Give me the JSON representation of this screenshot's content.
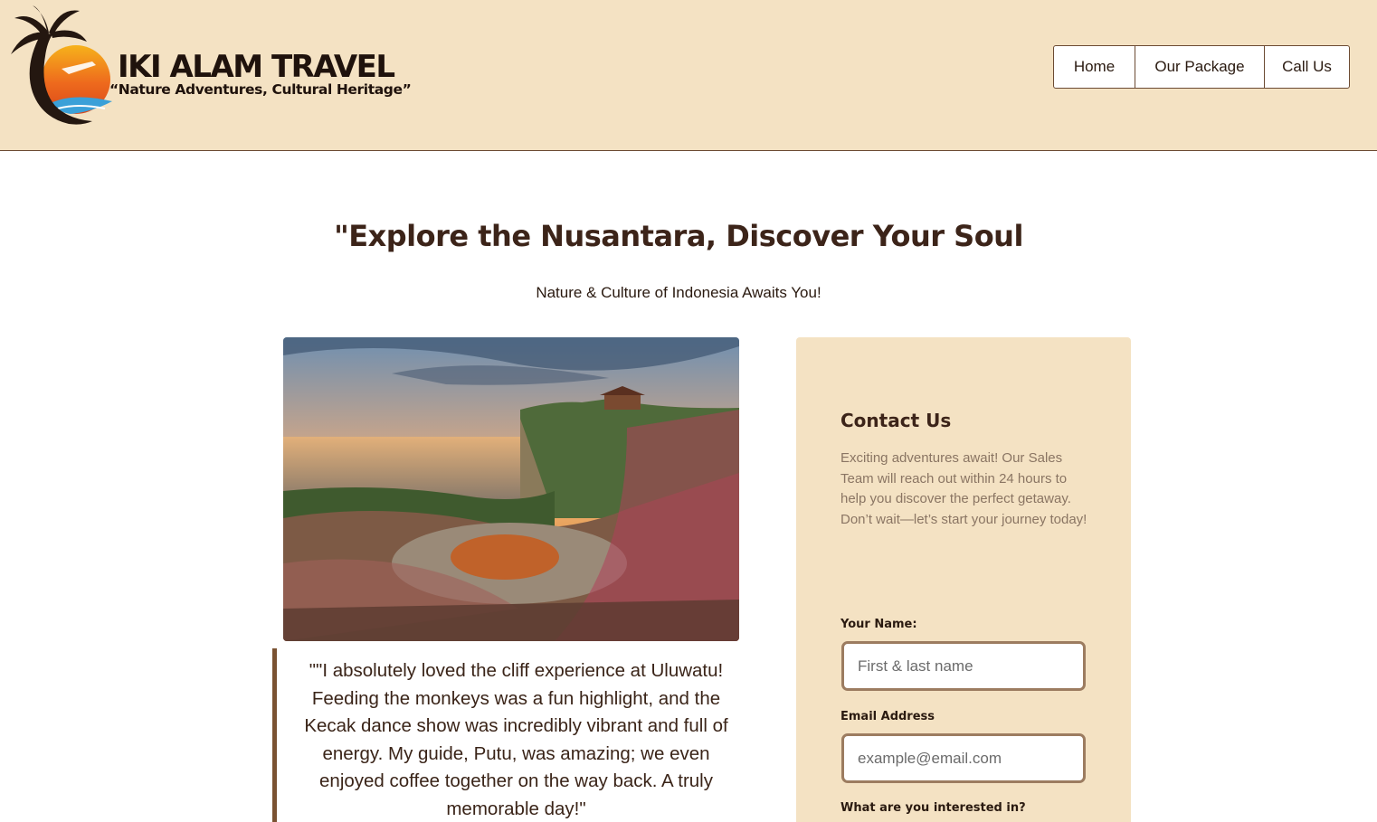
{
  "brand": {
    "name": "IKI ALAM TRAVEL",
    "tagline": "“Nature Adventures, Cultural Heritage”"
  },
  "nav": {
    "items": [
      {
        "label": "Home"
      },
      {
        "label": "Our Package"
      },
      {
        "label": "Call Us"
      }
    ]
  },
  "hero": {
    "title": "\"Explore the Nusantara, Discover Your Soul",
    "subtitle": "Nature & Culture of Indonesia Awaits You!"
  },
  "testimonial": {
    "text": "\"\"I absolutely loved the cliff experience at Uluwatu! Feeding the monkeys was a fun highlight, and the Kecak dance show was incredibly vibrant and full of energy. My guide, Putu, was amazing; we even enjoyed coffee together on the way back. A truly memorable day!\""
  },
  "contact": {
    "title": "Contact Us",
    "description": "Exciting adventures await! Our Sales Team will reach out within 24 hours to help you discover the perfect getaway. Don’t wait—let’s start your journey today!",
    "name_label": "Your Name:",
    "name_placeholder": "First & last name",
    "email_label": "Email Address",
    "email_placeholder": "example@email.com",
    "interest_label": "What are you interested in?"
  },
  "colors": {
    "header_bg": "#f4e2c3",
    "accent_brown": "#7a5232",
    "heading_text": "#3c2419"
  }
}
